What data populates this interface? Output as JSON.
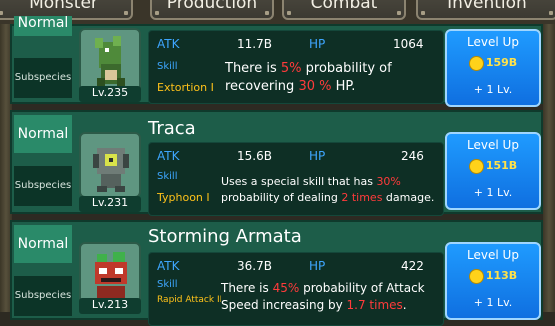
{
  "tabs": [
    {
      "label": "Monster"
    },
    {
      "label": "Production"
    },
    {
      "label": "Combat"
    },
    {
      "label": "Invention"
    }
  ],
  "stat_labels": {
    "atk": "ATK",
    "hp": "HP",
    "skill": "Skill",
    "subspecies": "Subspecies"
  },
  "monsters": [
    {
      "rarity": "Normal",
      "name": "",
      "level": "Lv.235",
      "atk": "11.7B",
      "hp": "1064",
      "skill_name": "Extortion I",
      "desc_line1": [
        "There is ",
        "5%",
        " probability of"
      ],
      "desc_line2": [
        "recovering ",
        "30 %",
        " HP."
      ],
      "level_up": {
        "label": "Level Up",
        "cost": "159B",
        "gain": "+ 1 Lv."
      }
    },
    {
      "rarity": "Normal",
      "name": "Traca",
      "level": "Lv.231",
      "atk": "15.6B",
      "hp": "246",
      "skill_name": "Typhoon I",
      "desc_line1": [
        "Uses a special skill that has ",
        "30%",
        ""
      ],
      "desc_line2": [
        "probability of dealing ",
        "2 times",
        " damage."
      ],
      "level_up": {
        "label": "Level Up",
        "cost": "151B",
        "gain": "+ 1 Lv."
      }
    },
    {
      "rarity": "Normal",
      "name": "Storming Armata",
      "level": "Lv.213",
      "atk": "36.7B",
      "hp": "422",
      "skill_name": "Rapid Attack II",
      "desc_line1": [
        "There is ",
        "45%",
        " probability of Attack"
      ],
      "desc_line2": [
        "Speed increasing by ",
        "1.7 times",
        "."
      ],
      "level_up": {
        "label": "Level Up",
        "cost": "113B",
        "gain": "+ 1 Lv."
      }
    }
  ],
  "colors": {
    "accent_red": "#ff3b3b",
    "skill_yellow": "#ffc21a",
    "label_blue": "#3ea6ff",
    "levelup_blue": "#1f9bff"
  }
}
